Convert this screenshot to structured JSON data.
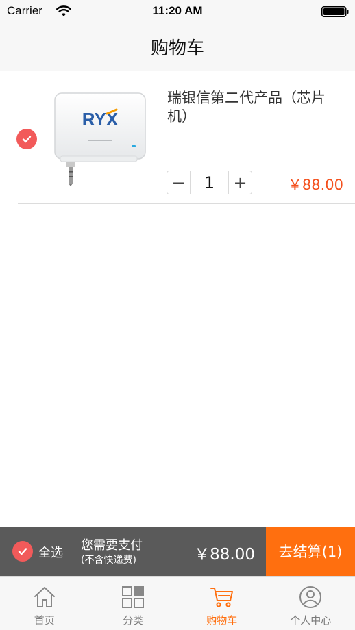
{
  "status_bar": {
    "carrier": "Carrier",
    "time": "11:20 AM",
    "wifi_icon": "wifi-icon",
    "battery_icon": "battery-icon"
  },
  "nav": {
    "title": "购物车"
  },
  "cart_items": [
    {
      "name": "瑞银信第二代产品（芯片机）",
      "quantity": "1",
      "minus": "−",
      "plus": "+",
      "price": "￥88.00",
      "checked": true,
      "thumb_icon": "card-reader-icon",
      "thumb_logo": "RYX"
    }
  ],
  "checkout": {
    "select_all_label": "全选",
    "pay_title": "您需要支付",
    "pay_subtitle": "(不含快递费)",
    "total": "￥88.00",
    "button_label": "去结算(1)"
  },
  "tabs": [
    {
      "label": "首页",
      "icon": "home-icon",
      "active": false
    },
    {
      "label": "分类",
      "icon": "category-grid-icon",
      "active": false
    },
    {
      "label": "购物车",
      "icon": "cart-icon",
      "active": true
    },
    {
      "label": "个人中心",
      "icon": "user-icon",
      "active": false
    }
  ],
  "colors": {
    "accent": "#ff6f0f",
    "price": "#f4511e",
    "check": "#f25a5a",
    "checkout_bar": "#5a5a5a"
  }
}
